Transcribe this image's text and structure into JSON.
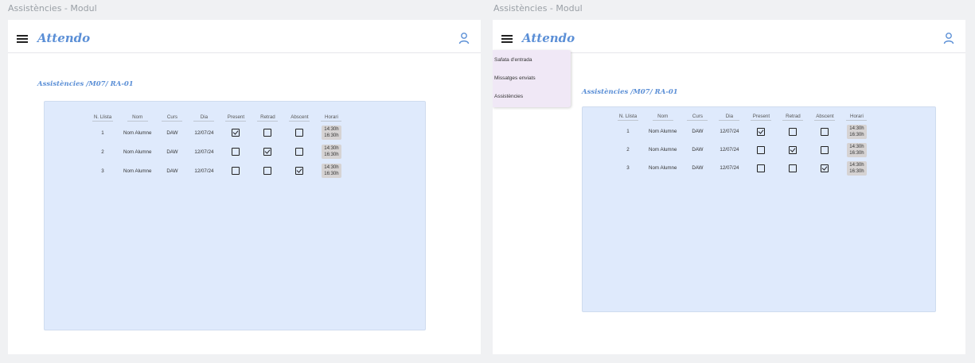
{
  "frame_label": "Assistències - Modul",
  "app": {
    "brand": "Attendo",
    "page_title": "Assistències /M07/ RA-01"
  },
  "drawer": {
    "items": [
      "Safata d'entrada",
      "Missatges enviats",
      "Assistències"
    ]
  },
  "table": {
    "headers": [
      "N. Llista",
      "Nom",
      "Curs",
      "Dia",
      "Present",
      "Retrad",
      "Abscent",
      "Horari"
    ],
    "rows": [
      {
        "num": "1",
        "name": "Nom Alumne",
        "course": "DAW",
        "date": "12/07/24",
        "present": true,
        "late": false,
        "absent": false,
        "time_start": "14:30h",
        "time_end": "16:30h"
      },
      {
        "num": "2",
        "name": "Nom Alumne",
        "course": "DAW",
        "date": "12/07/24",
        "present": false,
        "late": true,
        "absent": false,
        "time_start": "14:30h",
        "time_end": "16:30h"
      },
      {
        "num": "3",
        "name": "Nom Alumne",
        "course": "DAW",
        "date": "12/07/24",
        "present": false,
        "late": false,
        "absent": true,
        "time_start": "14:30h",
        "time_end": "16:30h"
      }
    ]
  },
  "colors": {
    "brand": "#5b8fd6",
    "panel": "#dfeafc",
    "drawer": "#f0e8f6"
  }
}
